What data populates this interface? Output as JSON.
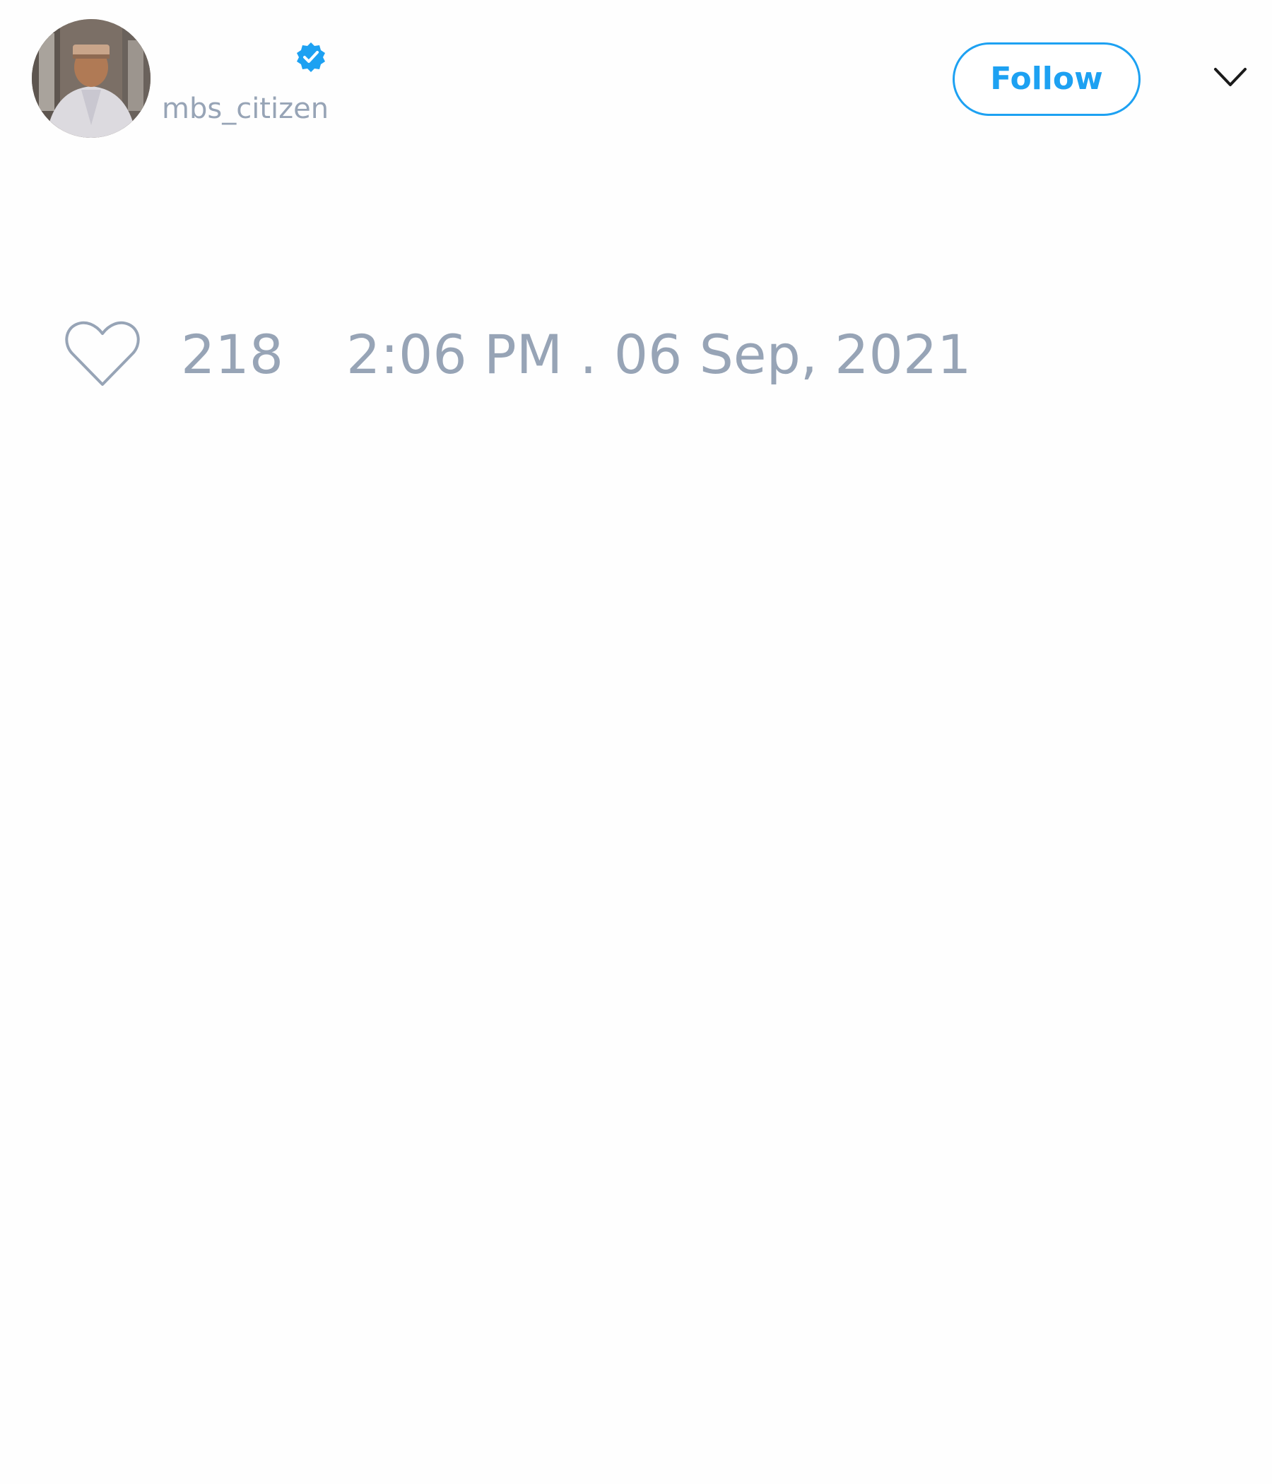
{
  "tweet": {
    "author": {
      "handle": "mbs_citizen",
      "verified": true,
      "avatar_icon": "user-photo"
    },
    "follow_label": "Follow",
    "menu_icon": "chevron-down-icon",
    "likes": {
      "icon": "heart-outline-icon",
      "count": "218"
    },
    "timestamp": "2:06 PM . 06 Sep, 2021"
  },
  "colors": {
    "accent": "#1da1f2",
    "muted_text": "#97a4b6",
    "background": "#fefefe"
  }
}
